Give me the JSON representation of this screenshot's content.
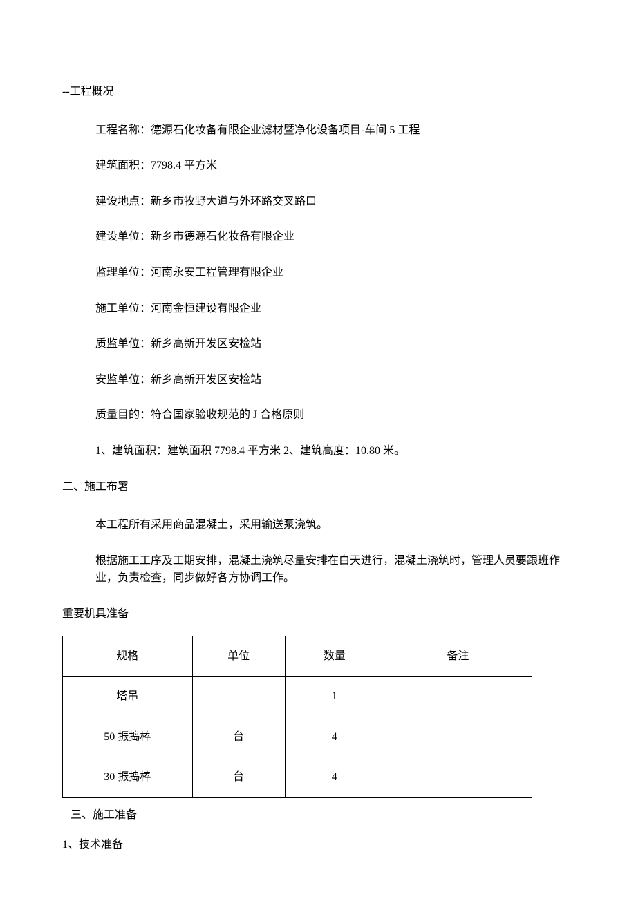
{
  "headings": {
    "h1": "--工程概况",
    "h2": "二、施工布署",
    "h3": "三、施工准备"
  },
  "overview": {
    "project_name": "工程名称：德源石化妆备有限企业滤材暨净化设备项目-车间 5 工程",
    "area": "建筑面积：7798.4 平方米",
    "location": "建设地点：新乡市牧野大道与外环路交叉路口",
    "builder": "建设单位：新乡市德源石化妆备有限企业",
    "supervisor": "监理单位：河南永安工程管理有限企业",
    "contractor": "施工单位：河南金恒建设有限企业",
    "quality_supervisor": "质监单位：新乡高新开发区安检站",
    "safety_supervisor": "安监单位：新乡高新开发区安检站",
    "quality_goal": "质量目的：符合国家验收规范的 J 合格原则",
    "summary": "1、建筑面积：建筑面积 7798.4 平方米 2、建筑高度：10.80 米。"
  },
  "deployment": {
    "p1": "本工程所有采用商品混凝土，采用输送泵浇筑。",
    "p2": "根据施工工序及工期安排，混凝土浇筑尽量安排在白天进行，混凝土浇筑时，管理人员要跟班作业，负责检查，同步做好各方协调工作。",
    "equip_heading": "重要机具准备"
  },
  "table": {
    "headers": {
      "spec": "规格",
      "unit": "单位",
      "qty": "数量",
      "note": "备注"
    },
    "rows": [
      {
        "spec": "塔吊",
        "unit": "",
        "qty": "1",
        "note": ""
      },
      {
        "spec": "50 振捣棒",
        "unit": "台",
        "qty": "4",
        "note": ""
      },
      {
        "spec": "30 振捣棒",
        "unit": "台",
        "qty": "4",
        "note": ""
      }
    ]
  },
  "prep": {
    "p1": "1、技术准备"
  }
}
